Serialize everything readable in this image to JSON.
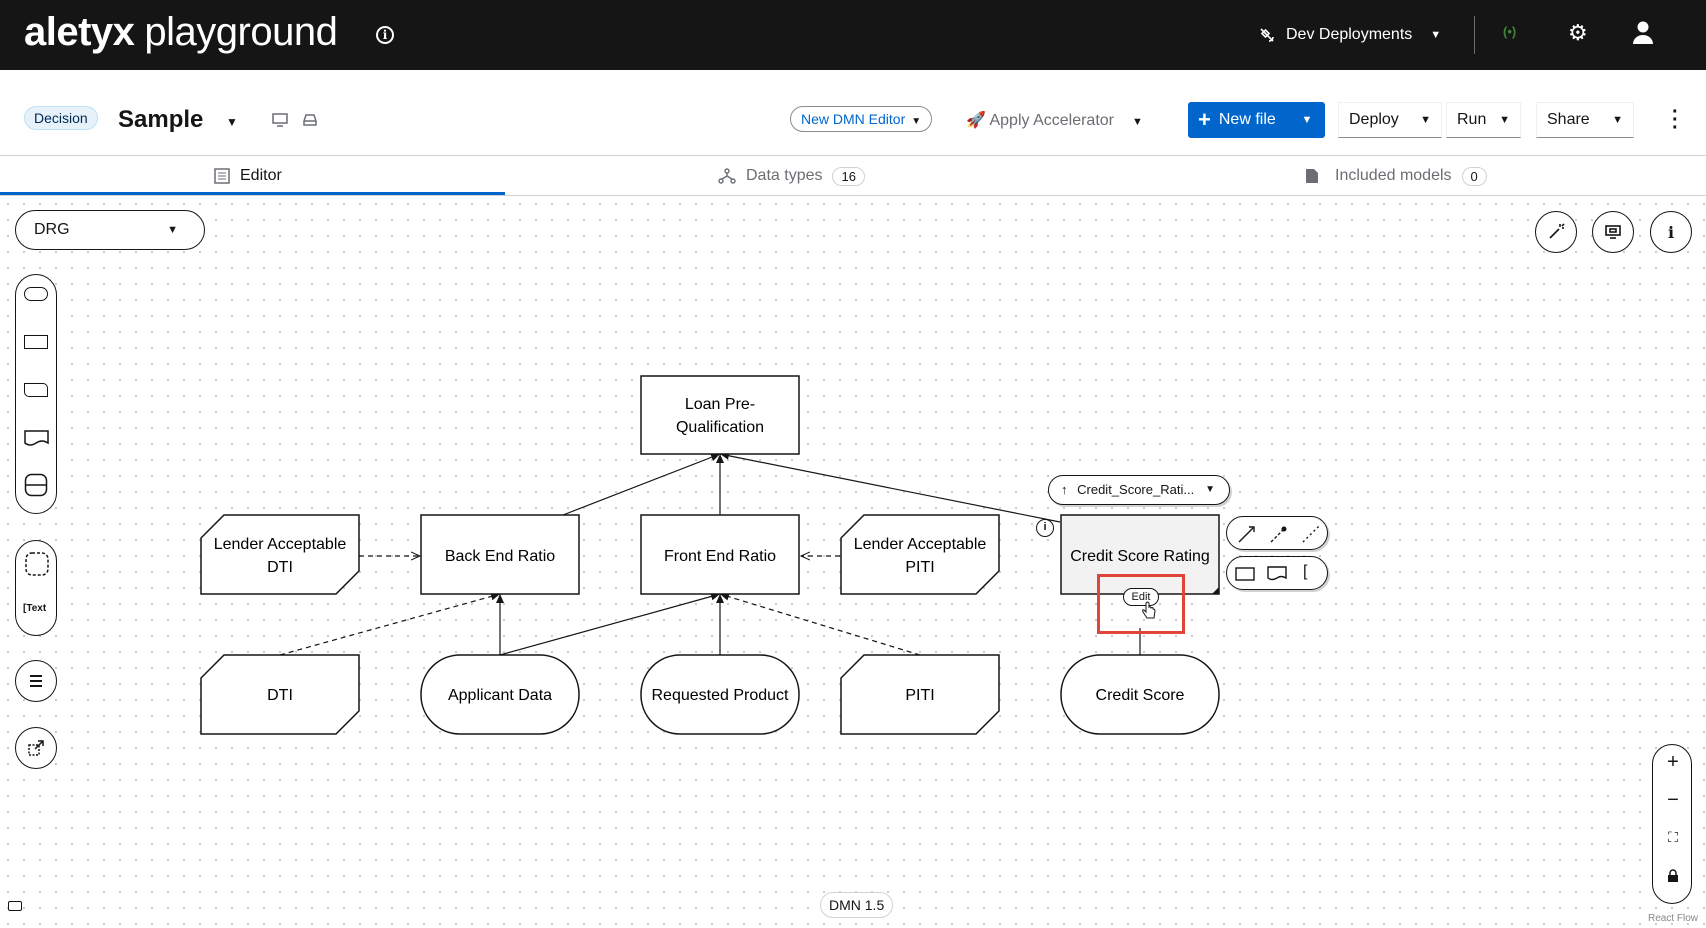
{
  "masthead": {
    "brand_bold": "aletyx",
    "brand_light": "playground",
    "deployments_label": "Dev Deployments"
  },
  "toolbar": {
    "type_badge": "Decision",
    "file_name": "Sample",
    "editor_chip": "New DMN Editor",
    "accelerator_label": "Apply Accelerator",
    "new_file_label": "New file",
    "deploy_label": "Deploy",
    "run_label": "Run",
    "share_label": "Share"
  },
  "tabs": [
    {
      "label": "Editor",
      "count": null,
      "active": true
    },
    {
      "label": "Data types",
      "count": "16",
      "active": false
    },
    {
      "label": "Included models",
      "count": "0",
      "active": false
    }
  ],
  "canvas": {
    "view_select": "DRG",
    "palette_text_label": "Text",
    "node_chip": "Credit_Score_Rati...",
    "edit_pill": "Edit",
    "dmn_version": "DMN 1.5",
    "react_flow_label": "React Flow"
  },
  "diagram": {
    "nodes": [
      {
        "id": "loan",
        "label": [
          "Loan Pre-",
          "Qualification"
        ],
        "kind": "decision"
      },
      {
        "id": "backend",
        "label": [
          "Back End Ratio"
        ],
        "kind": "decision"
      },
      {
        "id": "frontend",
        "label": [
          "Front End Ratio"
        ],
        "kind": "decision"
      },
      {
        "id": "csr",
        "label": [
          "Credit Score Rating"
        ],
        "kind": "decision"
      },
      {
        "id": "ladti",
        "label": [
          "Lender Acceptable",
          "DTI"
        ],
        "kind": "bkm"
      },
      {
        "id": "lapiti",
        "label": [
          "Lender Acceptable",
          "PITI"
        ],
        "kind": "bkm"
      },
      {
        "id": "dti",
        "label": [
          "DTI"
        ],
        "kind": "bkm"
      },
      {
        "id": "piti",
        "label": [
          "PITI"
        ],
        "kind": "bkm"
      },
      {
        "id": "applicant",
        "label": [
          "Applicant Data"
        ],
        "kind": "input"
      },
      {
        "id": "product",
        "label": [
          "Requested Product"
        ],
        "kind": "input"
      },
      {
        "id": "cs",
        "label": [
          "Credit Score"
        ],
        "kind": "input"
      }
    ]
  },
  "colors": {
    "masthead_bg": "#151515",
    "primary": "#0066cc",
    "highlight": "#e0453c",
    "connection_ok": "#3e8635"
  }
}
